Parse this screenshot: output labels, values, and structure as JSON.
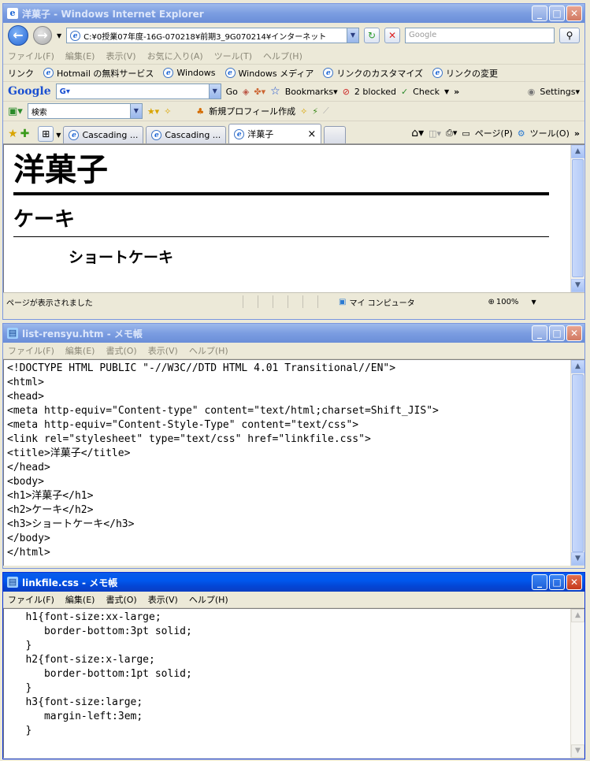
{
  "browser": {
    "title": "洋菓子 - Windows Internet Explorer",
    "address": "C:¥0授業07年度-16G-070218¥前期3_9G070214¥インターネット",
    "search_placeholder": "Google",
    "menu": [
      "ファイル(F)",
      "編集(E)",
      "表示(V)",
      "お気に入り(A)",
      "ツール(T)",
      "ヘルプ(H)"
    ],
    "links_label": "リンク",
    "links": [
      "Hotmail の無料サービス",
      "Windows",
      "Windows メディア",
      "リンクのカスタマイズ",
      "リンクの変更"
    ],
    "google_bar": {
      "logo": "Google",
      "go": "Go",
      "bookmarks": "Bookmarks▾",
      "blocked": "2 blocked",
      "check": "Check",
      "settings": "Settings▾"
    },
    "bar3": {
      "search_value": "検索",
      "profile": "新規プロフィール作成"
    },
    "tabs": [
      {
        "label": "Cascading ..."
      },
      {
        "label": "Cascading ..."
      },
      {
        "label": "洋菓子",
        "close": "×"
      }
    ],
    "cmd": {
      "page": "ページ(P)",
      "tools": "ツール(O)"
    },
    "page": {
      "h1": "洋菓子",
      "h2": "ケーキ",
      "h3": "ショートケーキ"
    },
    "status": {
      "text": "ページが表示されました",
      "zone": "マイ コンピュータ",
      "zoom": "100%"
    }
  },
  "notepad1": {
    "title": "list-rensyu.htm - メモ帳",
    "menu": [
      "ファイル(F)",
      "編集(E)",
      "書式(O)",
      "表示(V)",
      "ヘルプ(H)"
    ],
    "lines": [
      "<!DOCTYPE HTML PUBLIC \"-//W3C//DTD HTML 4.01 Transitional//EN\">",
      "<html>",
      "<head>",
      "<meta http-equiv=\"Content-type\" content=\"text/html;charset=Shift_JIS\">",
      "<meta http-equiv=\"Content-Style-Type\" content=\"text/css\">",
      "<link rel=\"stylesheet\" type=\"text/css\" href=\"linkfile.css\">",
      "<title>洋菓子</title>",
      "</head>",
      "<body>",
      "<h1>洋菓子</h1>",
      "<h2>ケーキ</h2>",
      "<h3>ショートケーキ</h3>",
      "</body>",
      "</html>"
    ]
  },
  "notepad2": {
    "title": "linkfile.css - メモ帳",
    "menu": [
      "ファイル(F)",
      "編集(E)",
      "書式(O)",
      "表示(V)",
      "ヘルプ(H)"
    ],
    "lines": [
      "   h1{font-size:xx-large;",
      "      border-bottom:3pt solid;",
      "   }",
      "   h2{font-size:x-large;",
      "      border-bottom:1pt solid;",
      "   }",
      "   h3{font-size:large;",
      "      margin-left:3em;",
      "   }"
    ]
  },
  "icons": {
    "ie": "ie-icon",
    "notepad": "notepad-icon"
  }
}
